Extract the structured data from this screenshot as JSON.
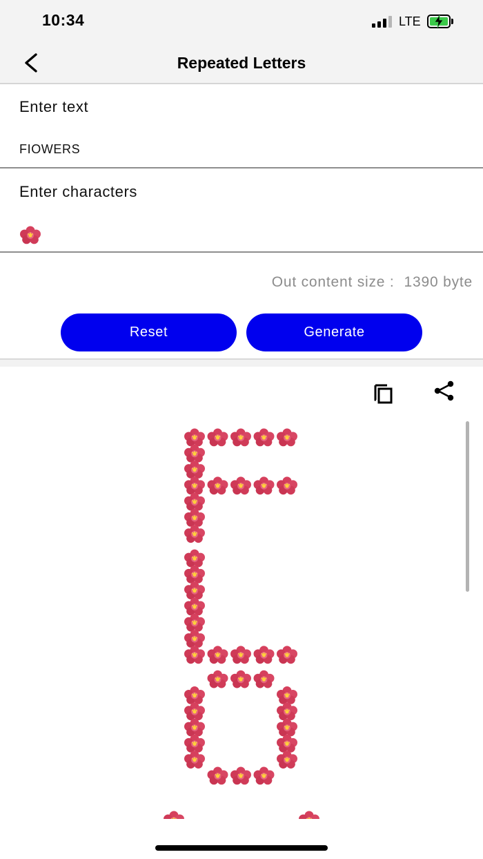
{
  "status_bar": {
    "time": "10:34",
    "network": "LTE",
    "battery_color": "#3bc94a"
  },
  "nav": {
    "title": "Repeated Letters",
    "back_icon": "chevron-left-icon"
  },
  "text_field": {
    "label": "Enter text",
    "value": "FIOWERS"
  },
  "char_field": {
    "label": "Enter characters",
    "value": "🌺"
  },
  "size_info": {
    "label": "Out content size :",
    "value": "1390 byte"
  },
  "buttons": {
    "reset_label": "Reset",
    "generate_label": "Generate",
    "color": "#0000ee"
  },
  "output": {
    "copy_icon": "copy-icon",
    "share_icon": "share-icon",
    "flower_icon": "hibiscus-icon",
    "text": "FIOWERS"
  }
}
